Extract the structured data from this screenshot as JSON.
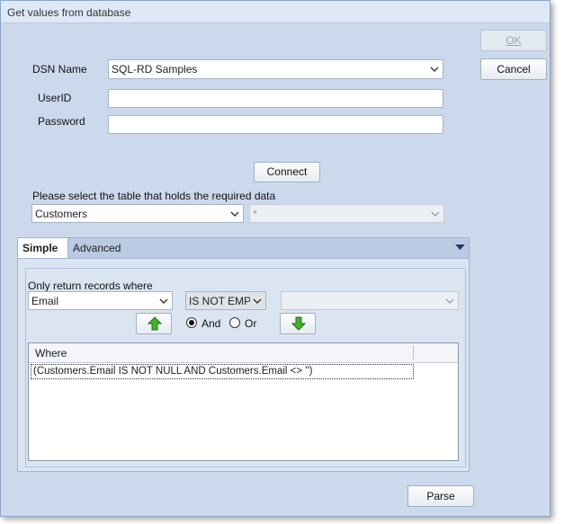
{
  "window": {
    "title": "Get values from database"
  },
  "buttons": {
    "ok": "OK",
    "cancel": "Cancel",
    "connect": "Connect",
    "parse": "Parse"
  },
  "form": {
    "dsn_label": "DSN Name",
    "dsn_value": "SQL-RD Samples",
    "userid_label": "UserID",
    "userid_value": "",
    "password_label": "Password",
    "password_value": ""
  },
  "table_select": {
    "prompt": "Please select the table that holds the required data",
    "table_value": "Customers",
    "column_value": "*"
  },
  "tabs": [
    {
      "label": "Simple",
      "active": true
    },
    {
      "label": "Advanced",
      "active": false
    }
  ],
  "filter": {
    "label": "Only return records where",
    "field_value": "Email",
    "operator_value": "IS NOT EMPTY",
    "value_value": "",
    "and_label": "And",
    "or_label": "Or",
    "selected_conjunction": "And"
  },
  "where_grid": {
    "column_header": "Where",
    "rows": [
      "(Customers.Email IS NOT NULL AND Customers.Email <> '')"
    ]
  },
  "icons": {
    "move_up": "green-up-arrow-icon",
    "move_down": "green-down-arrow-icon",
    "accent": "#3a9a24"
  }
}
